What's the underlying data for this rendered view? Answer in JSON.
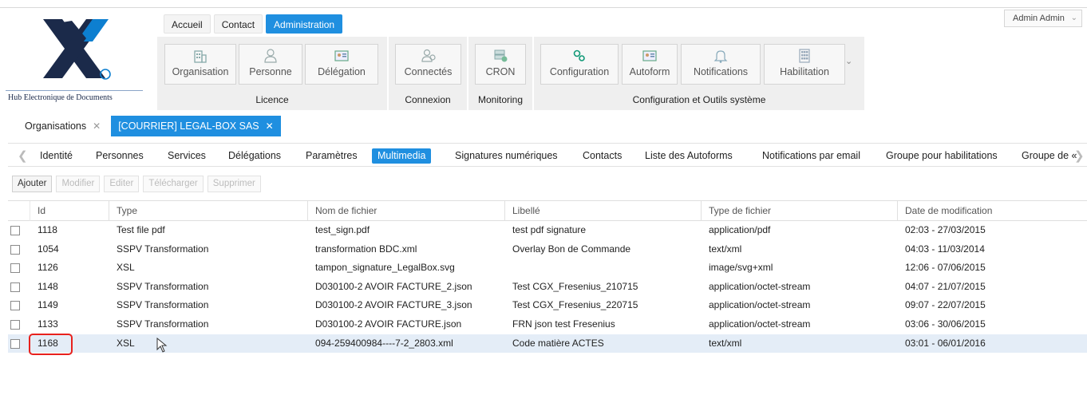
{
  "app": {
    "logo_caption": "Hub Electronique de Documents",
    "logo_mark": "©"
  },
  "main_nav": {
    "tabs": [
      {
        "label": "Accueil",
        "active": false
      },
      {
        "label": "Contact",
        "active": false
      },
      {
        "label": "Administration",
        "active": true
      }
    ]
  },
  "user_menu": {
    "label": "Admin Admin"
  },
  "ribbon": {
    "groups": [
      {
        "label": "Licence",
        "buttons": [
          {
            "label": "Organisation",
            "icon": "building-icon"
          },
          {
            "label": "Personne",
            "icon": "person-icon"
          },
          {
            "label": "Délégation",
            "icon": "id-card-icon"
          }
        ]
      },
      {
        "label": "Connexion",
        "buttons": [
          {
            "label": "Connectés",
            "icon": "users-icon"
          }
        ]
      },
      {
        "label": "Monitoring",
        "buttons": [
          {
            "label": "CRON",
            "icon": "server-icon"
          }
        ]
      },
      {
        "label": "Configuration et Outils système",
        "buttons": [
          {
            "label": "Configuration",
            "icon": "gears-icon"
          },
          {
            "label": "Autoform",
            "icon": "form-icon"
          },
          {
            "label": "Notifications",
            "icon": "bell-icon"
          },
          {
            "label": "Habilitation",
            "icon": "grid-icon"
          }
        ]
      }
    ]
  },
  "doc_tabs": [
    {
      "label": "Organisations",
      "active": false
    },
    {
      "label": "[COURRIER] LEGAL-BOX SAS",
      "active": true
    }
  ],
  "sub_tabs": [
    "Identité",
    "Personnes",
    "Services",
    "Délégations",
    "Paramètres",
    "Multimedia",
    "Signatures numériques",
    "Contacts",
    "Liste des Autoforms",
    "Notifications par email",
    "Groupe pour habilitations",
    "Groupe de «"
  ],
  "sub_tabs_active": "Multimedia",
  "toolbar": {
    "buttons": [
      {
        "label": "Ajouter",
        "enabled": true
      },
      {
        "label": "Modifier",
        "enabled": false
      },
      {
        "label": "Editer",
        "enabled": false
      },
      {
        "label": "Télécharger",
        "enabled": false
      },
      {
        "label": "Supprimer",
        "enabled": false
      }
    ]
  },
  "grid": {
    "columns": [
      "Id",
      "Type",
      "Nom de fichier",
      "Libellé",
      "Type de fichier",
      "Date de modification"
    ],
    "rows": [
      {
        "id": "1118",
        "type": "Test file pdf",
        "file": "test_sign.pdf",
        "libelle": "test pdf signature",
        "mime": "application/pdf",
        "date": "02:03 - 27/03/2015"
      },
      {
        "id": "1054",
        "type": "SSPV Transformation",
        "file": "transformation BDC.xml",
        "libelle": "Overlay Bon de Commande",
        "mime": "text/xml",
        "date": "04:03 - 11/03/2014"
      },
      {
        "id": "1126",
        "type": "XSL",
        "file": "tampon_signature_LegalBox.svg",
        "libelle": "",
        "mime": "image/svg+xml",
        "date": "12:06 - 07/06/2015"
      },
      {
        "id": "1148",
        "type": "SSPV Transformation",
        "file": "D030100-2 AVOIR FACTURE_2.json",
        "libelle": "Test CGX_Fresenius_210715",
        "mime": "application/octet-stream",
        "date": "04:07 - 21/07/2015"
      },
      {
        "id": "1149",
        "type": "SSPV Transformation",
        "file": "D030100-2 AVOIR FACTURE_3.json",
        "libelle": "Test CGX_Fresenius_220715",
        "mime": "application/octet-stream",
        "date": "09:07 - 22/07/2015"
      },
      {
        "id": "1133",
        "type": "SSPV Transformation",
        "file": "D030100-2 AVOIR FACTURE.json",
        "libelle": "FRN json test Fresenius",
        "mime": "application/octet-stream",
        "date": "03:06 - 30/06/2015"
      },
      {
        "id": "1168",
        "type": "XSL",
        "file": "094-259400984----7-2_2803.xml",
        "libelle": "Code matière ACTES",
        "mime": "text/xml",
        "date": "03:01 - 06/01/2016",
        "selected": true,
        "highlighted": true
      }
    ]
  },
  "colors": {
    "accent": "#1f8fe0",
    "logo_blue": "#0d7fd0",
    "logo_navy": "#1b2a4a",
    "selection": "#e4edf7",
    "highlight": "#e8211d"
  }
}
